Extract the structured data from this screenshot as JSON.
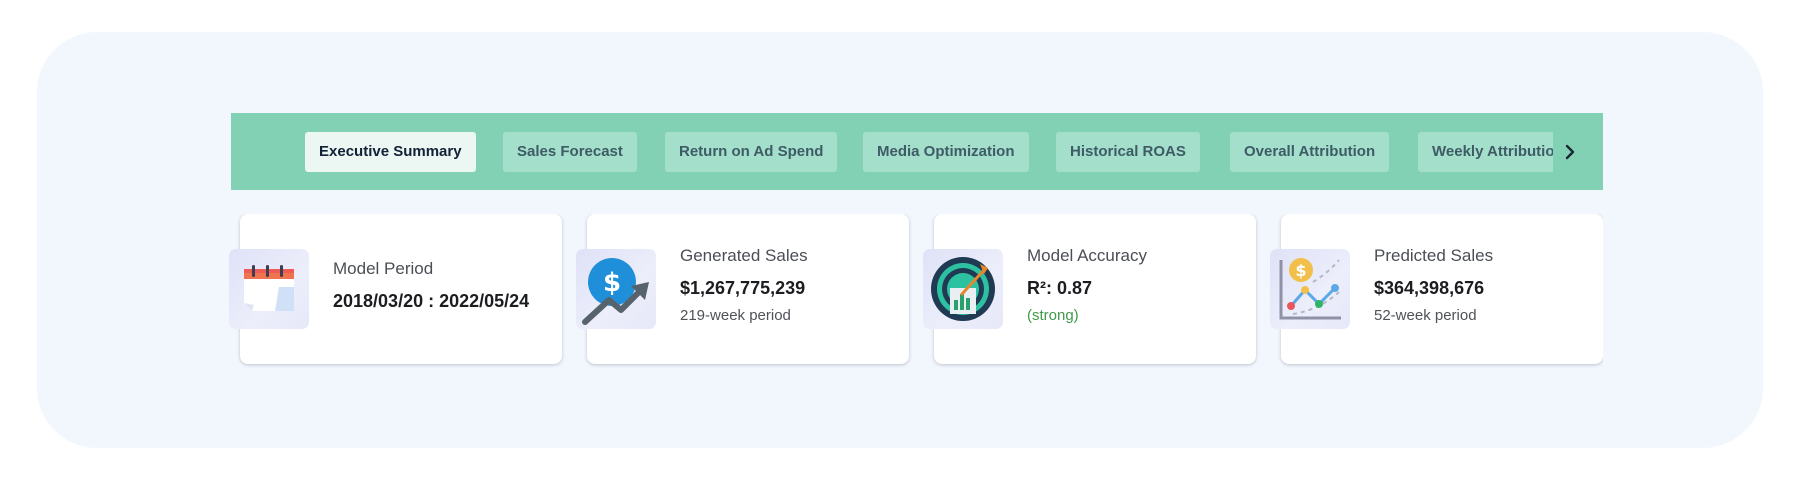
{
  "tabs": [
    {
      "label": "Executive Summary",
      "active": true
    },
    {
      "label": "Sales Forecast",
      "active": false
    },
    {
      "label": "Return on Ad Spend",
      "active": false
    },
    {
      "label": "Media Optimization",
      "active": false
    },
    {
      "label": "Historical ROAS",
      "active": false
    },
    {
      "label": "Overall Attribution",
      "active": false
    },
    {
      "label": "Weekly Attributio",
      "active": false
    }
  ],
  "tab_scroll_icon": "chevron-right-icon",
  "cards": [
    {
      "icon": "calendar-icon",
      "label": "Model Period",
      "value": "2018/03/20 : 2022/05/24",
      "sub": ""
    },
    {
      "icon": "dollar-growth-icon",
      "label": "Generated Sales",
      "value": "$1,267,775,239",
      "sub": "219-week period"
    },
    {
      "icon": "target-chart-icon",
      "label": "Model Accuracy",
      "value": "R²: 0.87",
      "sub": "(strong)"
    },
    {
      "icon": "prediction-chart-icon",
      "label": "Predicted Sales",
      "value": "$364,398,676",
      "sub": "52-week period"
    }
  ],
  "colors": {
    "tabbar": "#83d1b5",
    "tab": "#a3dfca",
    "active_tab": "#ecf6f3",
    "strong_text": "#3f9b4a",
    "background": "#f2f6fd"
  }
}
